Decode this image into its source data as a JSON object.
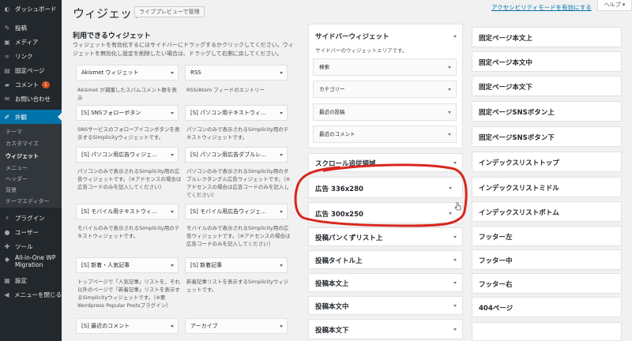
{
  "sidebar": {
    "items": [
      {
        "label": "ダッシュボード",
        "icon": "dashboard-icon"
      },
      {
        "label": "投稿",
        "icon": "pin-icon"
      },
      {
        "label": "メディア",
        "icon": "media-icon"
      },
      {
        "label": "リンク",
        "icon": "link-icon"
      },
      {
        "label": "固定ページ",
        "icon": "page-icon"
      },
      {
        "label": "コメント",
        "icon": "comment-icon",
        "badge": "1"
      },
      {
        "label": "お問い合わせ",
        "icon": "mail-icon"
      },
      {
        "label": "外観",
        "icon": "brush-icon"
      },
      {
        "label": "プラグイン",
        "icon": "plugin-icon"
      },
      {
        "label": "ユーザー",
        "icon": "user-icon"
      },
      {
        "label": "ツール",
        "icon": "wrench-icon"
      },
      {
        "label": "All-in-One WP Migration",
        "icon": "migration-icon"
      },
      {
        "label": "設定",
        "icon": "settings-icon"
      },
      {
        "label": "メニューを閉じる",
        "icon": "collapse-icon"
      }
    ],
    "submenu": [
      "テーマ",
      "カスタマイズ",
      "ウィジェット",
      "メニュー",
      "ヘッダー",
      "背景",
      "テーマエディター"
    ]
  },
  "header": {
    "title": "ウィジェット",
    "live_preview": "ライブプレビューで管理",
    "accessibility_link": "アクセシビリティモードを有効にする",
    "help": "ヘルプ ▾"
  },
  "available": {
    "title": "利用できるウィジェット",
    "desc": "ウィジェットを有効化するにはサイドバーにドラッグするかクリックしてください。ウィジェットを無効化し設定を削除したい場合は、ドラッグして右側に戻してください。",
    "widgets": [
      {
        "name": "Akismet ウィジェット",
        "desc": "Akismet が捕獲したスパムコメント数を表示"
      },
      {
        "name": "RSS",
        "desc": "RSS/Atom フィードのエントリー"
      },
      {
        "name": "[S] SNSフォローボタン",
        "desc": "SNSサービスのフォローアイコンボタンを表示するSimplicityウィジェットです。"
      },
      {
        "name": "[S] パソコン用テキストウィ...",
        "desc": "パソコンのみで表示されるSimplicity用のテキストウィジェットです。"
      },
      {
        "name": "[S] パソコン用広告ウィジェ...",
        "desc": "パソコンのみで表示されるSimplicity用の広告ウィジェットです。（※アドセンスの場合は広告コードのみを記入してください）"
      },
      {
        "name": "[S] パソコン用広告ダブルレ...",
        "desc": "パソコンのみで表示されるSimplicity用のダブルレクタングル広告ウィジェットです。（※アドセンスの場合は広告コードのみを記入してください）"
      },
      {
        "name": "[S] モバイル用テキストウィ...",
        "desc": "モバイルのみで表示されるSimplicity用のテキストウィジェットです。"
      },
      {
        "name": "[S] モバイル用広告ウィジェ...",
        "desc": "モバイルのみで表示されるSimplicity用の広告ウィジェットです。（※アドセンスの場合は広告コードのみを記入してください）"
      },
      {
        "name": "[S] 新着・人気記事",
        "desc": "トップページで「人気記事」リストを、それ以外のページで「新着記事」リストを表示するSimplicityウィジェットです。（※要Wordpress Popular Postsプラグイン）"
      },
      {
        "name": "[S] 新着記事",
        "desc": "新着記事リストを表示するSimplicityウィジェットです。"
      },
      {
        "name": "[S] 最近のコメント",
        "desc": ""
      },
      {
        "name": "アーカイブ",
        "desc": ""
      }
    ]
  },
  "sidebar_widget": {
    "title": "サイドバーウィジェット",
    "desc": "サイドバーのウィジェットエリアです。",
    "widgets": [
      "検索",
      "カテゴリー",
      "最近の投稿",
      "最近のコメント"
    ]
  },
  "areas_middle": [
    "スクロール追従領域",
    "広告 336x280",
    "広告 300x250",
    "投稿パンくずリスト上",
    "投稿タイトル上",
    "投稿本文上",
    "投稿本文中",
    "投稿本文下"
  ],
  "areas_right": [
    "固定ページ本文上",
    "固定ページ本文中",
    "固定ページ本文下",
    "固定ページSNSボタン上",
    "固定ページSNSボタン下",
    "インデックスリストトップ",
    "インデックスリストミドル",
    "インデックスリストボトム",
    "フッター左",
    "フッター中",
    "フッター右",
    "404ページ",
    ""
  ],
  "colors": {
    "sidebar_bg": "#23282d",
    "accent": "#0073aa",
    "annotation": "#d7261e"
  }
}
